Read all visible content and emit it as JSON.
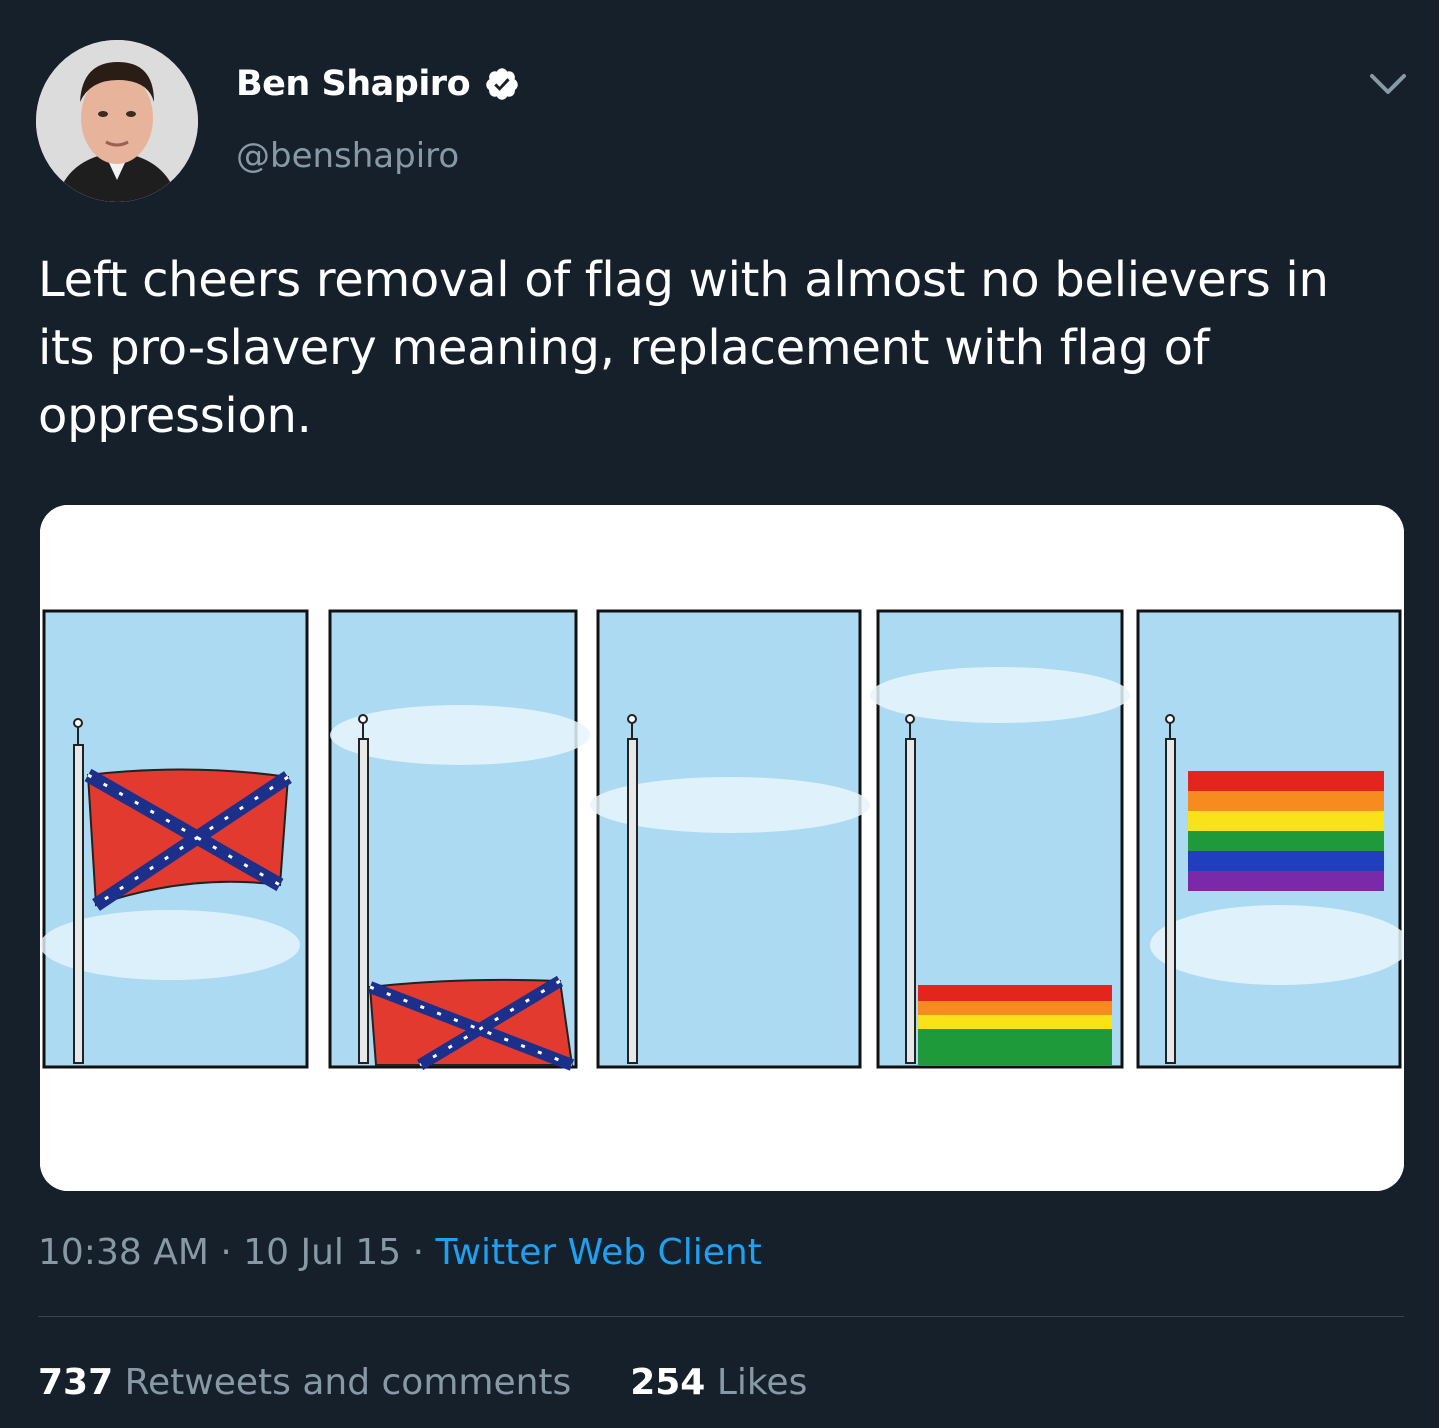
{
  "tweet": {
    "author": {
      "name": "Ben Shapiro",
      "handle": "@benshapiro",
      "verified": true
    },
    "text": "Left cheers removal of flag with almost no believers in its pro-slavery meaning, replacement with flag of oppression.",
    "media": {
      "panels": [
        {
          "flag": "confederate",
          "position": "top"
        },
        {
          "flag": "confederate",
          "position": "bottom"
        },
        {
          "flag": "none",
          "position": "none"
        },
        {
          "flag": "rainbow",
          "position": "bottom"
        },
        {
          "flag": "rainbow",
          "position": "top"
        }
      ]
    },
    "time": "10:38 AM",
    "date": "10 Jul 15",
    "separator": " · ",
    "client": "Twitter Web Client",
    "retweets_count": "737",
    "retweets_label": "Retweets and comments",
    "likes_count": "254",
    "likes_label": "Likes"
  },
  "colors": {
    "background": "#15202b",
    "secondary_text": "#8899a6",
    "link": "#1da1f2",
    "divider": "#38444d"
  },
  "icons": {
    "verified": "verified-badge-icon",
    "menu": "chevron-down-icon"
  }
}
